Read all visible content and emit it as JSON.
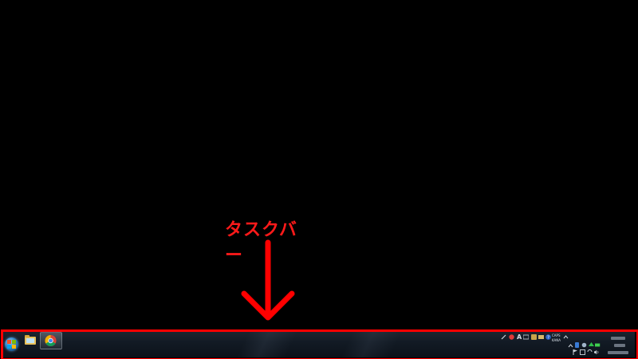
{
  "annotation": {
    "label": "タスクバー",
    "color": "#ff0000"
  },
  "desktop": {
    "background": "#000000"
  },
  "taskbar": {
    "start_button_icon": "windows-orb-icon",
    "pinned_items": [
      {
        "name": "explorer",
        "icon": "folder-icon"
      },
      {
        "name": "chrome",
        "icon": "chrome-icon",
        "active": true
      }
    ],
    "tray": {
      "text_small_top": "CAPS",
      "text_small_bottom": "KANA",
      "ime_label": "A"
    }
  }
}
